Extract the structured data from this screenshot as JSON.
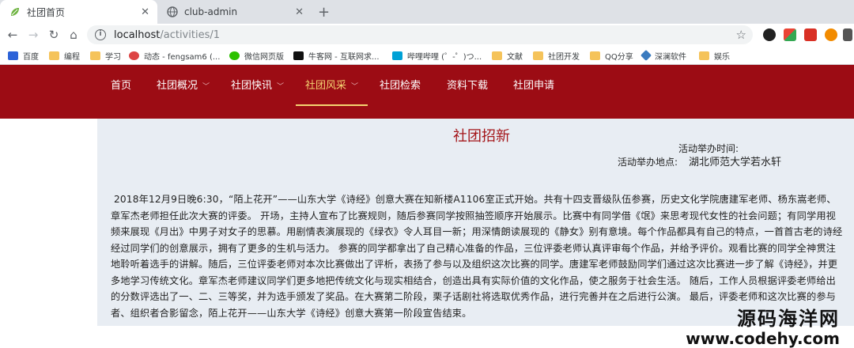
{
  "browser": {
    "tabs": [
      {
        "title": "社团首页",
        "active": true
      },
      {
        "title": "club-admin",
        "active": false
      }
    ],
    "url_host": "localhost",
    "url_path": "/activities/1",
    "bookmarks": [
      "百度",
      "编程",
      "学习",
      "动态 - fengsam6 (...",
      "微信网页版",
      "牛客网 - 互联网求...",
      "哔哩哔哩 (゜-゜)つ...",
      "文献",
      "社团开发",
      "QQ分享",
      "深澜软件",
      "娱乐"
    ]
  },
  "nav": {
    "items": [
      {
        "label": "首页",
        "dropdown": false,
        "active": false
      },
      {
        "label": "社团概况",
        "dropdown": true,
        "active": false
      },
      {
        "label": "社团快讯",
        "dropdown": true,
        "active": false
      },
      {
        "label": "社团风采",
        "dropdown": true,
        "active": true
      },
      {
        "label": "社团检索",
        "dropdown": false,
        "active": false
      },
      {
        "label": "资料下载",
        "dropdown": false,
        "active": false
      },
      {
        "label": "社团申请",
        "dropdown": false,
        "active": false
      }
    ]
  },
  "article": {
    "title": "社团招新",
    "time_label": "活动举办时间:",
    "time_value": "",
    "place_label": "活动举办地点:",
    "place_value": "湖北师范大学若水轩",
    "body": "2018年12月9日晚6:30，“陌上花开”——山东大学《诗经》创意大赛在知新楼A1106室正式开始。共有十四支晋级队伍参赛，历史文化学院唐建军老师、杨东嵩老师、章军杰老师担任此次大赛的评委。 开场，主持人宣布了比赛规则，随后参赛同学按照抽签顺序开始展示。比赛中有同学借《氓》来思考现代女性的社会问题；有同学用视频来展现《月出》中男子对女子的思慕。用剧情表演展现的《绿衣》令人耳目一新；用深情朗读展现的《静女》别有意境。每个作品都具有自己的特点，一首首古老的诗经经过同学们的创意展示，拥有了更多的生机与活力。 参赛的同学都拿出了自己精心准备的作品，三位评委老师认真评审每个作品，并给予评价。观看比赛的同学全神贯注地聆听着选手的讲解。随后，三位评委老师对本次比赛做出了评析，表扬了参与以及组织这次比赛的同学。唐建军老师鼓励同学们通过这次比赛进一步了解《诗经》，并更多地学习传统文化。章军杰老师建议同学们更多地把传统文化与现实相结合，创造出具有实际价值的文化作品，使之服务于社会生活。 随后，工作人员根据评委老师给出的分数评选出了一、二、三等奖，并为选手颁发了奖品。在大赛第二阶段，栗子话剧社将选取优秀作品，进行完善并在之后进行公演。 最后，评委老师和这次比赛的参与者、组织者合影留念，陌上花开——山东大学《诗经》创意大赛第一阶段宣告结束。"
  },
  "watermark": {
    "line1": "源码海洋网",
    "line2": "www.codehy.com"
  },
  "colors": {
    "nav_bg": "#9c0c14",
    "nav_active": "#f4d372",
    "title": "#a4161a",
    "content_bg": "#e8edf3"
  }
}
